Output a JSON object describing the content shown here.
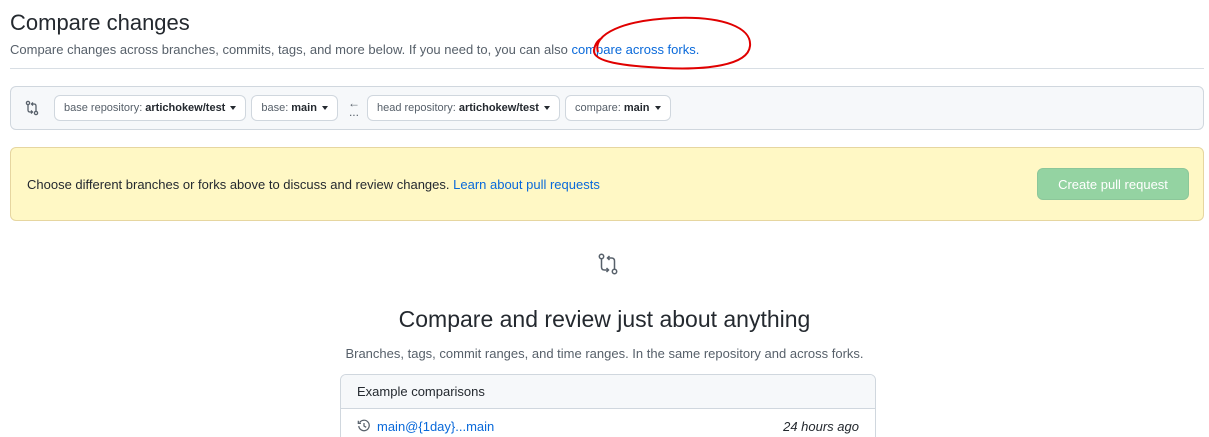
{
  "header": {
    "title": "Compare changes",
    "subtitle": "Compare changes across branches, commits, tags, and more below. If you need to, you can also ",
    "forks_link": "compare across forks."
  },
  "range": {
    "base_repo_label": "base repository:",
    "base_repo_value": "artichokew/test",
    "base_label": "base:",
    "base_value": "main",
    "arrow": "←",
    "dots": "...",
    "head_repo_label": "head repository:",
    "head_repo_value": "artichokew/test",
    "compare_label": "compare:",
    "compare_value": "main"
  },
  "flash": {
    "text": "Choose different branches or forks above to discuss and review changes. ",
    "link": "Learn about pull requests",
    "button": "Create pull request"
  },
  "blankslate": {
    "title": "Compare and review just about anything",
    "subtitle": "Branches, tags, commit ranges, and time ranges. In the same repository and across forks."
  },
  "examples": {
    "header": "Example comparisons",
    "items": [
      {
        "ref": "main@{1day}...main",
        "time": "24 hours ago"
      }
    ]
  },
  "icons": {
    "compare": "git-compare-icon",
    "history": "history-icon"
  },
  "colors": {
    "link": "#0969da",
    "flash_bg": "#fff8c5",
    "button_disabled": "#94d3a2",
    "annotation": "#e00000"
  }
}
